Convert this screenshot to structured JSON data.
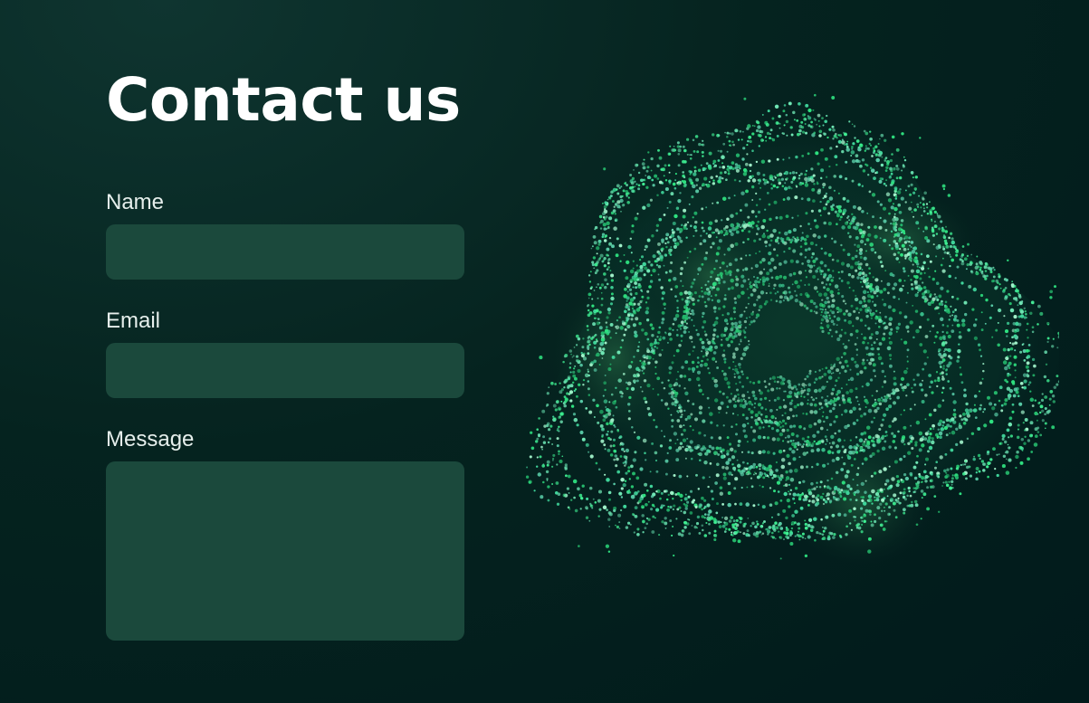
{
  "page": {
    "title": "Contact us"
  },
  "form": {
    "name": {
      "label": "Name",
      "value": "",
      "placeholder": ""
    },
    "email": {
      "label": "Email",
      "value": "",
      "placeholder": ""
    },
    "message": {
      "label": "Message",
      "value": "",
      "placeholder": ""
    }
  },
  "illustration": {
    "icon": "particle-sphere-illustration"
  },
  "colors": {
    "background": "#011a1b",
    "field_background": "#1b493c",
    "accent": "#2ee07f",
    "text": "#ffffff"
  }
}
